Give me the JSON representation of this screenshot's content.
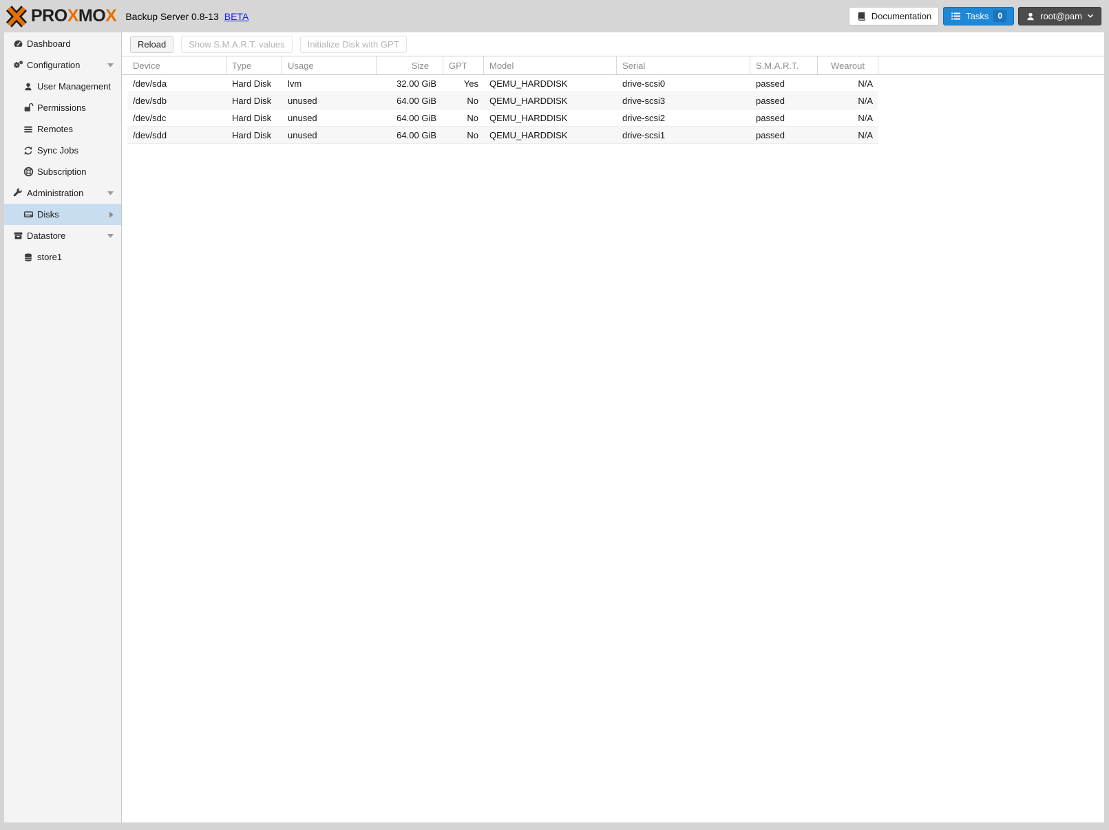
{
  "topbar": {
    "logo": {
      "p1": "PRO",
      "x1": "X",
      "p2": "MO",
      "x2": "X"
    },
    "title": "Backup Server 0.8-13",
    "beta_link": "BETA",
    "documentation_button": "Documentation",
    "tasks_button": "Tasks",
    "tasks_badge": "0",
    "user_menu": "root@pam"
  },
  "sidebar": {
    "items": [
      {
        "label": "Dashboard",
        "icon": "dashboard-icon",
        "level": 0
      },
      {
        "label": "Configuration",
        "icon": "cogs-icon",
        "level": 0,
        "expanded": true
      },
      {
        "label": "User Management",
        "icon": "user-icon",
        "level": 1
      },
      {
        "label": "Permissions",
        "icon": "unlock-icon",
        "level": 1
      },
      {
        "label": "Remotes",
        "icon": "list-icon",
        "level": 1
      },
      {
        "label": "Sync Jobs",
        "icon": "sync-icon",
        "level": 1
      },
      {
        "label": "Subscription",
        "icon": "life-ring-icon",
        "level": 1
      },
      {
        "label": "Administration",
        "icon": "wrench-icon",
        "level": 0,
        "expanded": true
      },
      {
        "label": "Disks",
        "icon": "hdd-icon",
        "level": 1,
        "selected": true
      },
      {
        "label": "Datastore",
        "icon": "archive-icon",
        "level": 0,
        "expanded": true
      },
      {
        "label": "store1",
        "icon": "database-icon",
        "level": 1
      }
    ]
  },
  "toolbar": {
    "reload": "Reload",
    "show_smart": "Show S.M.A.R.T. values",
    "init_gpt": "Initialize Disk with GPT"
  },
  "disks_table": {
    "columns": [
      "Device",
      "Type",
      "Usage",
      "Size",
      "GPT",
      "Model",
      "Serial",
      "S.M.A.R.T.",
      "Wearout"
    ],
    "rows": [
      {
        "device": "/dev/sda",
        "type": "Hard Disk",
        "usage": "lvm",
        "size": "32.00 GiB",
        "gpt": "Yes",
        "model": "QEMU_HARDDISK",
        "serial": "drive-scsi0",
        "smart": "passed",
        "wearout": "N/A"
      },
      {
        "device": "/dev/sdb",
        "type": "Hard Disk",
        "usage": "unused",
        "size": "64.00 GiB",
        "gpt": "No",
        "model": "QEMU_HARDDISK",
        "serial": "drive-scsi3",
        "smart": "passed",
        "wearout": "N/A"
      },
      {
        "device": "/dev/sdc",
        "type": "Hard Disk",
        "usage": "unused",
        "size": "64.00 GiB",
        "gpt": "No",
        "model": "QEMU_HARDDISK",
        "serial": "drive-scsi2",
        "smart": "passed",
        "wearout": "N/A"
      },
      {
        "device": "/dev/sdd",
        "type": "Hard Disk",
        "usage": "unused",
        "size": "64.00 GiB",
        "gpt": "No",
        "model": "QEMU_HARDDISK",
        "serial": "drive-scsi1",
        "smart": "passed",
        "wearout": "N/A"
      }
    ]
  },
  "colors": {
    "brand_orange": "#e57000",
    "accent_blue": "#1e87d6",
    "selected_nav_bg": "#c9ddf1",
    "link_blue": "#1c1cf0",
    "user_button_bg": "#4c4c4c"
  }
}
